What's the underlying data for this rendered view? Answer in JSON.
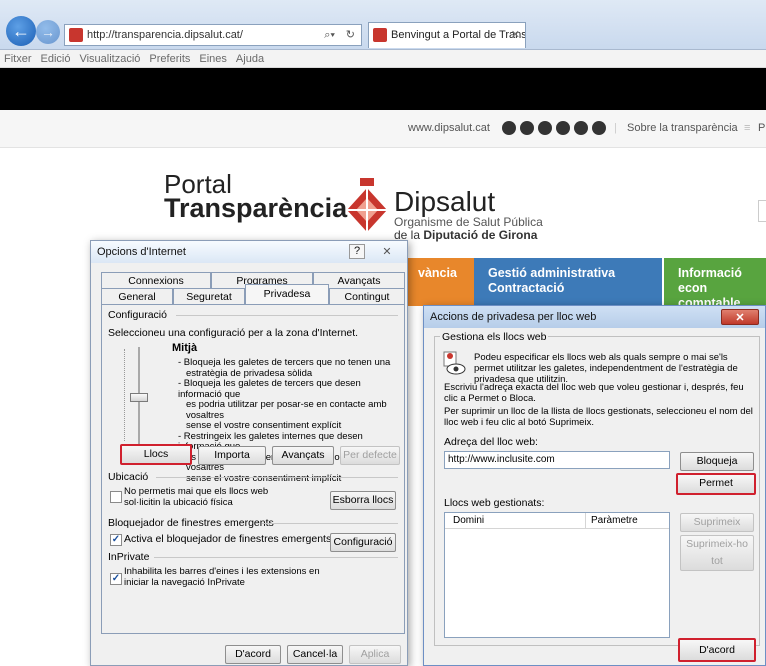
{
  "browser": {
    "url": "http://transparencia.dipsalut.cat/",
    "tab_title": "Benvingut a Portal de Trans...",
    "menu": [
      "Fitxer",
      "Edició",
      "Visualització",
      "Preferits",
      "Eines",
      "Ajuda"
    ]
  },
  "site": {
    "domain": "www.dipsalut.cat",
    "nav_link_1": "Sobre la transparència",
    "nav_link_2": "Preg",
    "portal_line1": "Portal",
    "portal_line2": "Transparència",
    "brand": "Dipsalut",
    "brand_sub1": "Organisme de Salut Pública",
    "brand_sub2_prefix": "de la",
    "brand_sub2_bold": "Diputació de Girona",
    "tiles": [
      {
        "label": "vància",
        "color": "#e8872b"
      },
      {
        "label": "Gestió administrativa Contractació",
        "color": "#3d7ab8"
      },
      {
        "label": "Informació econ comptable, pressupostària i",
        "color": "#58a43f"
      }
    ]
  },
  "internet_options": {
    "title": "Opcions d'Internet",
    "help": "?",
    "close": "✕",
    "tabs_back": [
      "Connexions",
      "Programes",
      "Avançats"
    ],
    "tabs_front": [
      "General",
      "Seguretat",
      "Privadesa",
      "Contingut"
    ],
    "group_config": "Configuració",
    "zone_prompt": "Seleccioneu una configuració per a la zona d'Internet.",
    "level": "Mitjà",
    "desc": [
      "- Bloqueja les galetes de tercers que no tenen una",
      "estratègia de privadesa sòlida",
      "- Bloqueja les galetes de tercers que desen informació que",
      "es podria utilitzar per posar-se en contacte amb vosaltres",
      "sense el vostre consentiment explícit",
      "- Restringeix les galetes internes que desen informació que",
      "es podria utilitzar per posar-se en contacte amb vosaltres",
      "sense el vostre consentiment implícit"
    ],
    "btn_llocs": "Llocs",
    "btn_importa": "Importa",
    "btn_avancats": "Avançats",
    "btn_defecte": "Per defecte",
    "group_ubicacio": "Ubicació",
    "ubicacio_check": "No permetis mai que els llocs web sol·licitin la ubicació física",
    "btn_esborra": "Esborra llocs",
    "group_bloquejador": "Bloquejador de finestres emergents",
    "bloquejador_check": "Activa el bloquejador de finestres emergents",
    "btn_configuracio": "Configuració",
    "group_inprivate": "InPrivate",
    "inprivate_check": "Inhabilita les barres d'eines i les extensions en iniciar la navegació InPrivate",
    "btn_dacord": "D'acord",
    "btn_cancella": "Cancel·la",
    "btn_aplica": "Aplica"
  },
  "site_privacy": {
    "title": "Accions de privadesa per lloc web",
    "close": "✕",
    "group": "Gestiona els llocs web",
    "intro": "Podeu especificar els llocs web als quals sempre o mai se'ls permet utilitzar les galetes, independentment de l'estratègia de privadesa que utilitzin.",
    "instr1": "Escriviu l'adreça exacta del lloc web que voleu gestionar i, després, feu clic a Permet o Bloca.",
    "instr2": "Per suprimir un lloc de la llista de llocs gestionats, seleccioneu el nom del lloc web i feu clic al botó Suprimeix.",
    "addr_label": "Adreça del lloc web:",
    "addr_value": "http://www.inclusite.com",
    "btn_bloqueja": "Bloqueja",
    "btn_permet": "Permet",
    "managed_label": "Llocs web gestionats:",
    "col_domini": "Domini",
    "col_parametre": "Paràmetre",
    "btn_suprimeix": "Suprimeix",
    "btn_suprimeix_tot": "Suprimeix-ho tot",
    "btn_dacord": "D'acord"
  }
}
